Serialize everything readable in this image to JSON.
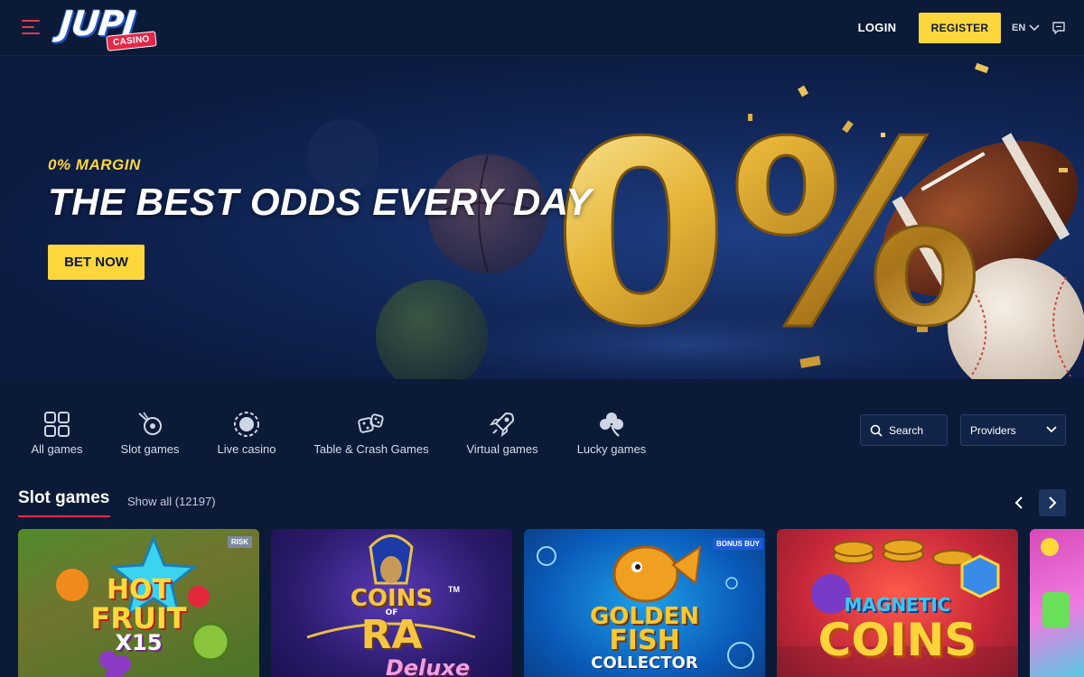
{
  "header": {
    "logo_text": "JUPI",
    "logo_badge": "CASINO",
    "login_label": "LOGIN",
    "register_label": "REGISTER",
    "language": "EN"
  },
  "hero": {
    "kicker": "0% MARGIN",
    "title": "THE BEST ODDS EVERY DAY",
    "cta_label": "BET NOW",
    "big_number": "0%"
  },
  "categories": [
    {
      "label": "All games",
      "icon": "grid-icon"
    },
    {
      "label": "Slot games",
      "icon": "slot-icon"
    },
    {
      "label": "Live casino",
      "icon": "live-icon"
    },
    {
      "label": "Table & Crash Games",
      "icon": "dice-icon"
    },
    {
      "label": "Virtual games",
      "icon": "rocket-icon"
    },
    {
      "label": "Lucky games",
      "icon": "clover-icon"
    }
  ],
  "search": {
    "placeholder": "Search"
  },
  "providers": {
    "label": "Providers"
  },
  "slot_section": {
    "title": "Slot games",
    "show_all": "Show all (12197)"
  },
  "games": [
    {
      "title_line1": "HOT",
      "title_line2": "FRUIT",
      "title_line3": "X15",
      "tag": "RISK"
    },
    {
      "title_line1": "COINS",
      "title_line2": "RA",
      "title_line3": "Deluxe",
      "small": "OF",
      "tm": "TM"
    },
    {
      "title_line1": "GOLDEN",
      "title_line2": "FISH",
      "title_line3": "COLLECTOR",
      "tag": "BONUS BUY"
    },
    {
      "title_line1": "MAGNETIC",
      "title_line2": "COINS"
    }
  ],
  "colors": {
    "background": "#0b1a36",
    "accent_yellow": "#fdd73c",
    "accent_red": "#e2284a"
  }
}
